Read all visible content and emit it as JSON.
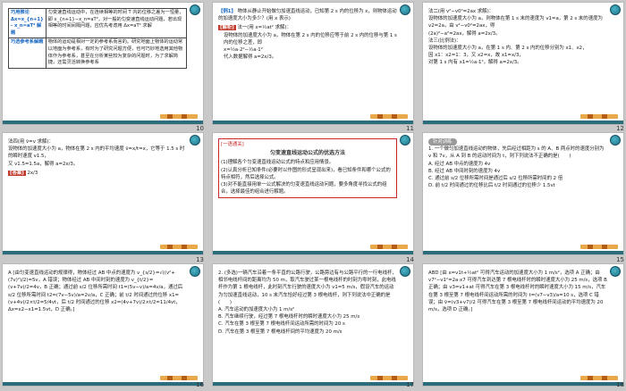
{
  "slides": [
    {
      "number": "10",
      "table": [
        {
          "key": "巧用推论 Δx=x_{n+1} - x_n=aT² 解题",
          "text": "匀变速直线运动中，在连续相等的时间 T 内的位移之差为一恒量，即 x_{n+1}−x_n=aT²，对一般的匀变速直线运动问题，若出现相等的时间间隔问题，应优先考虑用 Δx=aT² 求解"
        },
        {
          "key": "巧选参考系解题",
          "text": "物体的运动是相对一定的参考系而言的。研究地面上物体的运动常以地面为参考系，有时为了研究问题方便，也可巧妙地选用其他物体作为参考系，甚至在分析某些较为复杂的问题时，为了求解简捷，还需灵活转换参考系"
        }
      ]
    },
    {
      "number": "11",
      "title": "【例1】",
      "lines": [
        "物体从静止开始做匀加速直线运动，已知第 2 s 内的位移为 x，则物体运动的加速度大小为多少？(用 x 表示)"
      ],
      "jiexi": "[解析]",
      "method": "法一(用 x=½at² 求解)：",
      "more": [
        "设物体的加速度大小为 a，物体在第 2 s 内的位移应等于前 2 s 内的位移与第 1 s 内的位移之差，即",
        "x=½a·2²−½a·1²",
        "代入数据解得 a=2x/3。"
      ]
    },
    {
      "number": "12",
      "lines": [
        "法二(用 v²−v0²=2ax 求解)：",
        "设物体的加速度大小为 a，则物体在第 1 s 末的速度为 v1=a，第 2 s 末的速度为 v2=2a，由 v²−v0²=2ax，得",
        "(2a)²−a²=2ax，解得 a=2x/3。",
        "法三(比例法)：",
        "设物体的加速度大小为 a，在第 1 s 内、第 2 s 内的位移分别为 x1、x2，",
        "因 x1：x2=1：3，又 x2=x，故 x1=x/3，",
        "对第 1 s 内有 x1=½a·1²，解得 a=2x/3。"
      ]
    },
    {
      "number": "13",
      "lines": [
        "法四(用 v̄=v 求解)：",
        "设物体的加速度大小为 a，物体在第 2 s 内的平均速度 v̄=x/t=x，它等于 1.5 s 时的瞬时速度 v1.5，",
        "又 v1.5=1.5a，解得 a=2x/3。"
      ],
      "answer_tag": "[答案]",
      "answer": "2x/3"
    },
    {
      "number": "14",
      "tag": "[一语通关]",
      "title": "匀变速直线运动公式的优选方法",
      "lines": [
        "(1)理解各个匀变速直线运动公式的特点和应用情景。",
        "(2)认真分析已知条件(必要时以作图的形式呈现出来)，看已知条件和哪个公式的特点相符，然后选择公式。",
        "(3)对不能直接用单一公式解决的匀变速直线运动问题，要多角度寻找公式的组合，选择最佳的组合进行解题。"
      ]
    },
    {
      "number": "15",
      "pill": "针对训练",
      "lines": [
        "1. 一个做匀加速直线运动的物体，先后经过相距为 s 的 A、B 两点时的速度分别为 v 和 7v，从 A 到 B 的运动时间为 t，则下列说法不正确的是(　　)",
        "A. 经过 AB 中点的速度为 4v",
        "B. 经过 AB 中间时刻的速度为 4v",
        "C. 通过前 s/2 位移所需时间是通过后 s/2 位移所需时间的 2 倍",
        "D. 前 t/2 时间通过的位移比后 t/2 时间通过的位移少 1.5vt"
      ]
    },
    {
      "number": "16",
      "lines": [
        "A [由匀变速直线运动的规律得，物体经过 AB 中点的速度为 v_{s/2}=√((v²+(7v)²)/2)=5v，A 错误；物体经过 AB 中间时刻的速度为 v_{t/2}=(v+7v)/2=4v，B 正确；通过前 s/2 位移所需时间 t1=(5v−v)/a=4v/a，通过后 s/2 位移所需时间 t2=(7v−5v)/a=2v/a，C 正确；前 t/2 时间通过的位移 x1=(v+4v)/2×t/2=5/4vt，后 t/2 时间通过的位移 x2=(4v+7v)/2×t/2=11/4vt，Δx=x2−x1=1.5vt，D 正确。]"
      ]
    },
    {
      "number": "17",
      "lines": [
        "2. (多选)一辆汽车沿着一条平直的公路行驶，公路旁边有与公路平行的一行电线杆，相邻电线杆间的距离均为 50 m，取汽车驶过某一根电线杆的时刻为零时刻，此电线杆作为第 1 根电线杆，此时刻汽车行驶的速度大小为 v1=5 m/s，假设汽车的运动为匀加速直线运动，10 s 末汽车恰好经过第 3 根电线杆，则下列说法中正确的是(　　)",
        "A. 汽车运动的加速度大小为 1 m/s²",
        "B. 汽车继续行驶，经过第 7 根电线杆时的瞬时速度大小为 25 m/s",
        "C. 汽车在第 3 根至第 7 根电线杆间运动所需的时间为 20 s",
        "D. 汽车在第 3 根至第 7 根电线杆间的平均速度为 20 m/s"
      ]
    },
    {
      "number": "18",
      "lines": [
        "ABD [由 x=v1t+½at² 可得汽车运动的加速度大小为 1 m/s²，选项 A 正确；由 v7²−v1²=2a·x7 可得汽车到达第 7 根电线杆时的瞬时速度大小为 25 m/s，选项 B 正确；由 v3=v1+at 可得汽车在第 3 根电线杆时的瞬时速度大小为 15 m/s，汽车在第 3 根至第 7 根电线杆间运动所需的时间为 t=(v7−v3)/a=10 s，选项 C 错误；由 v̄=(v3+v7)/2 可得汽车在第 3 根至第 7 根电线杆间运动的平均速度为 20 m/s，选项 D 正确。]"
      ]
    }
  ]
}
